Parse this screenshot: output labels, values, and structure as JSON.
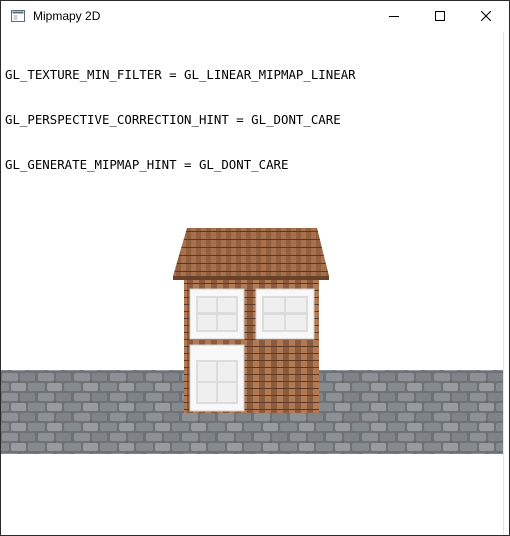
{
  "window": {
    "title": "Mipmapy 2D",
    "icons": [
      "app-icon",
      "minimize-icon",
      "maximize-icon",
      "close-icon"
    ]
  },
  "info_lines": [
    "GL_TEXTURE_MIN_FILTER = GL_LINEAR_MIPMAP_LINEAR",
    "GL_PERSPECTIVE_CORRECTION_HINT = GL_DONT_CARE",
    "GL_GENERATE_MIPMAP_HINT = GL_DONT_CARE"
  ],
  "colors": {
    "roof": "#8a5537",
    "wall": "#9c6845",
    "window_frame": "#f7f7f7",
    "ground": "#6f7378"
  }
}
